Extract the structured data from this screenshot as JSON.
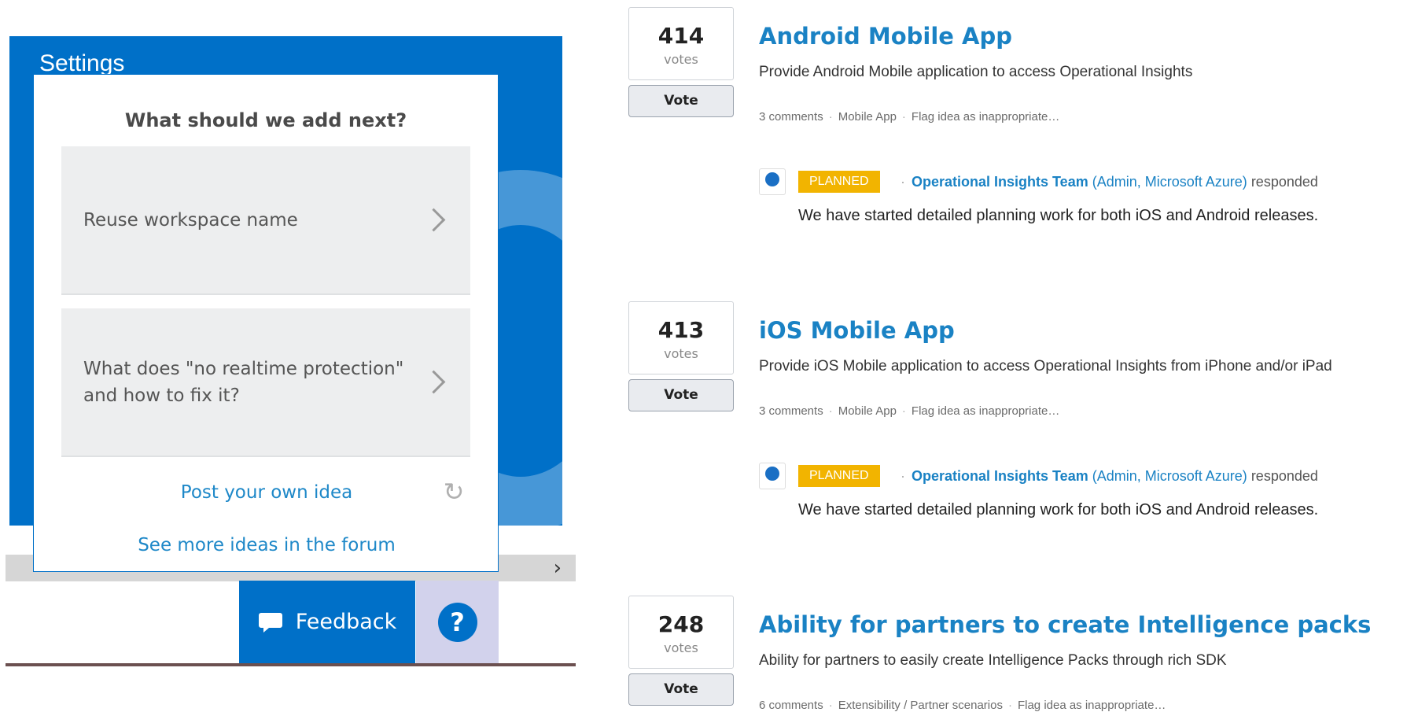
{
  "settings": {
    "title": "Settings"
  },
  "popup": {
    "heading": "What should we add next?",
    "ideas": [
      {
        "text": "Reuse workspace name"
      },
      {
        "text": "What does \"no realtime protection\" and how to fix it?"
      }
    ],
    "post_link": "Post your own idea",
    "forum_link": "See more ideas in the forum"
  },
  "feedback_button": {
    "label": "Feedback"
  },
  "help_button": {
    "label": "?"
  },
  "forum": {
    "vote_label": "Vote",
    "votes_word": "votes",
    "flag_text": "Flag idea as inappropriate…",
    "ideas": [
      {
        "votes": "414",
        "title": "Android Mobile App",
        "description": "Provide Android Mobile application to access Operational Insights",
        "comments": "3 comments",
        "category": "Mobile App",
        "response": {
          "status": "PLANNED",
          "team": "Operational Insights Team",
          "role": "(Admin, Microsoft Azure)",
          "verb": "responded",
          "text": "We have started detailed planning work for both iOS and Android releases."
        }
      },
      {
        "votes": "413",
        "title": "iOS Mobile App",
        "description": "Provide iOS Mobile application to access Operational Insights from iPhone and/or iPad",
        "comments": "3 comments",
        "category": "Mobile App",
        "response": {
          "status": "PLANNED",
          "team": "Operational Insights Team",
          "role": "(Admin, Microsoft Azure)",
          "verb": "responded",
          "text": "We have started detailed planning work for both iOS and Android releases."
        }
      },
      {
        "votes": "248",
        "title": "Ability for partners to create Intelligence packs",
        "description": "Ability for partners to easily create Intelligence Packs through rich SDK",
        "comments": "6 comments",
        "category": "Extensibility / Partner scenarios"
      }
    ]
  },
  "colors": {
    "brand_blue": "#0070c8",
    "link_blue": "#1a82c4",
    "planned_badge": "#f2b400"
  }
}
